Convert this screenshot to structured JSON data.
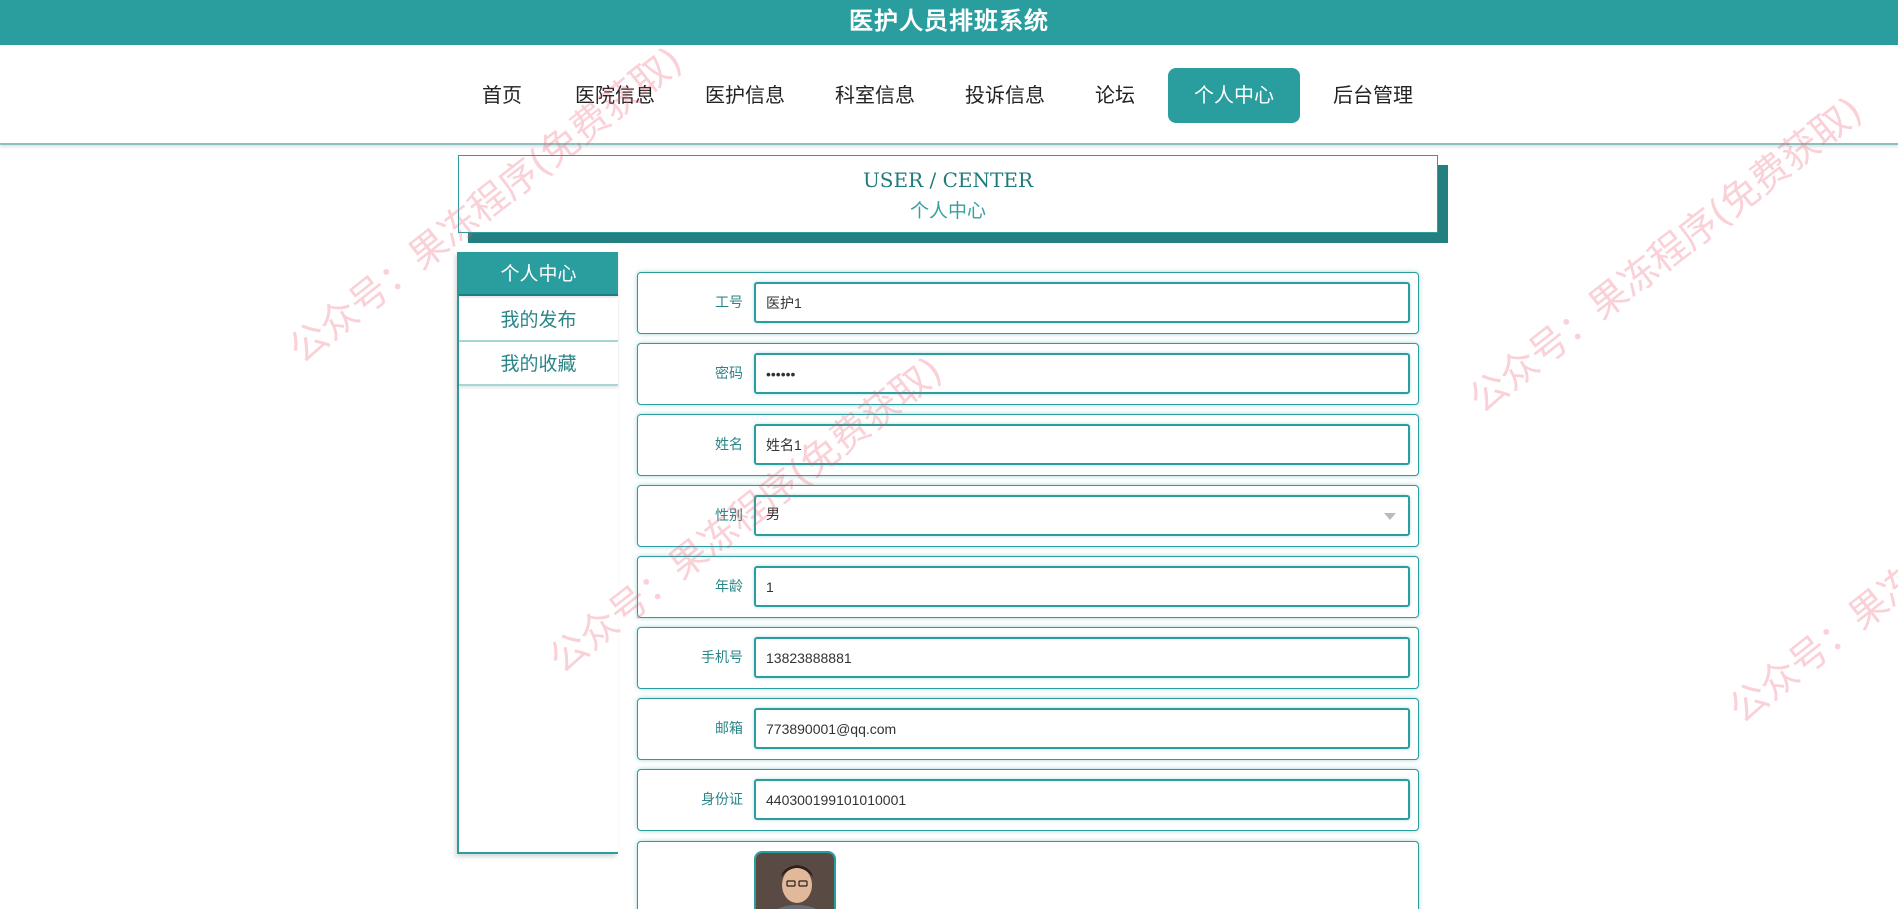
{
  "app": {
    "title": "医护人员排班系统"
  },
  "nav": {
    "items": [
      {
        "label": "首页"
      },
      {
        "label": "医院信息"
      },
      {
        "label": "医护信息"
      },
      {
        "label": "科室信息"
      },
      {
        "label": "投诉信息"
      },
      {
        "label": "论坛"
      },
      {
        "label": "个人中心",
        "active": true
      },
      {
        "label": "后台管理"
      }
    ]
  },
  "center_title": {
    "en": "USER / CENTER",
    "cn": "个人中心"
  },
  "sidebar": {
    "items": [
      {
        "label": "个人中心",
        "active": true
      },
      {
        "label": "我的发布"
      },
      {
        "label": "我的收藏"
      }
    ]
  },
  "form": {
    "gonghao": {
      "label": "工号",
      "value": "医护1"
    },
    "mima": {
      "label": "密码",
      "value": "123456"
    },
    "xingming": {
      "label": "姓名",
      "value": "姓名1"
    },
    "xingbie": {
      "label": "性别",
      "value": "男"
    },
    "nianling": {
      "label": "年龄",
      "value": "1"
    },
    "shouji": {
      "label": "手机号",
      "value": "13823888881"
    },
    "youxiang": {
      "label": "邮箱",
      "value": "773890001@qq.com"
    },
    "shenfenzheng": {
      "label": "身份证",
      "value": "440300199101010001"
    }
  },
  "watermark": {
    "text": "公众号：果冻程序(免费获取)"
  },
  "colors": {
    "accent": "#2a9d9f",
    "accent_dark": "#247f81",
    "watermark": "#e85a6e"
  }
}
